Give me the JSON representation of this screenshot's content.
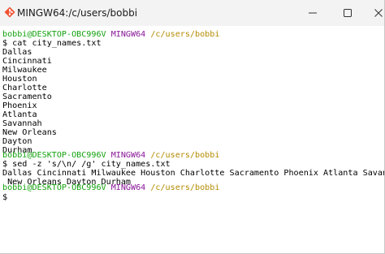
{
  "window": {
    "title": "MINGW64:/c/users/bobbi"
  },
  "prompt": {
    "user": "bobbi@DESKTOP-OBC996V",
    "host": "MINGW64",
    "path": "/c/users/bobbi",
    "symbol": "$"
  },
  "colors": {
    "user": "#13a10e",
    "host": "#881798",
    "path": "#b58b00",
    "text": "#000000",
    "titlebar": "#f3f3f3"
  },
  "commands": {
    "cat": "cat city_names.txt",
    "sed": "sed -z 's/\\n/ /g' city_names.txt"
  },
  "cat_output": [
    "Dallas",
    "Cincinnati",
    "Milwaukee",
    "Houston",
    "Charlotte",
    "Sacramento",
    "Phoenix",
    "Atlanta",
    "Savannah",
    "New Orleans",
    "Dayton",
    "Durham"
  ],
  "sed_output": [
    "Dallas Cincinnati Milwaukee Houston Charlotte Sacramento Phoenix Atlanta Savannah",
    " New Orleans Dayton Durham"
  ]
}
